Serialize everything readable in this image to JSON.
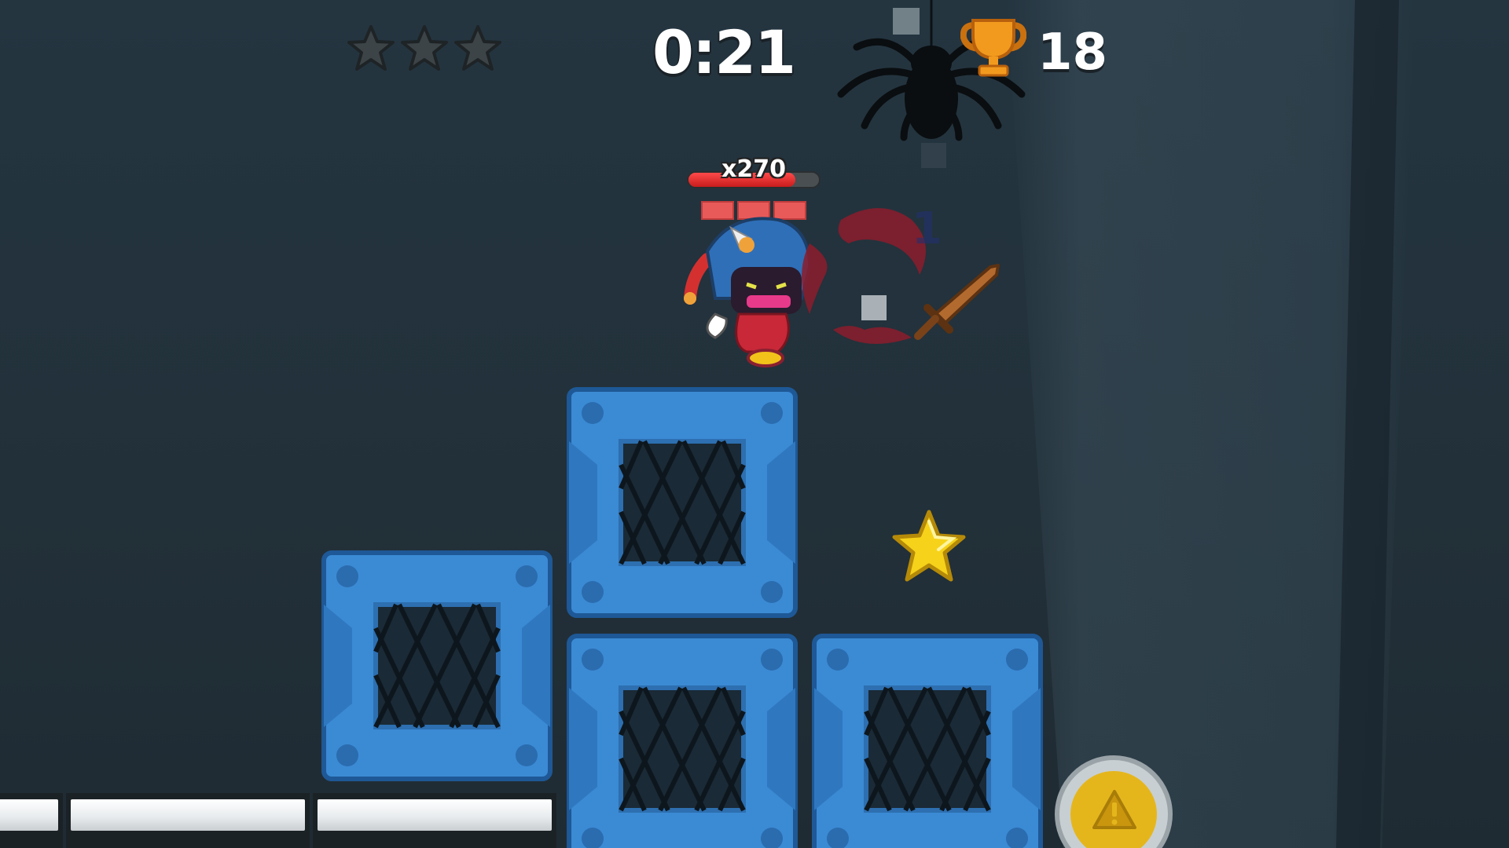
{
  "hud": {
    "level_stars_earned": 0,
    "level_stars_total": 3,
    "timer": "0:21",
    "trophy_count": "18"
  },
  "player": {
    "multiplier_label": "x270",
    "health_fraction": 0.82,
    "ammo_segments": 3
  },
  "colors": {
    "background": "#223039",
    "crate_blue": "#3b8ad4",
    "star_gold": "#f6d21a",
    "health_red": "#e02a2a",
    "trophy_orange": "#f29a1e"
  },
  "icons": {
    "hud_star": "star-outline-icon",
    "trophy": "trophy-icon",
    "action": "warning-icon"
  }
}
